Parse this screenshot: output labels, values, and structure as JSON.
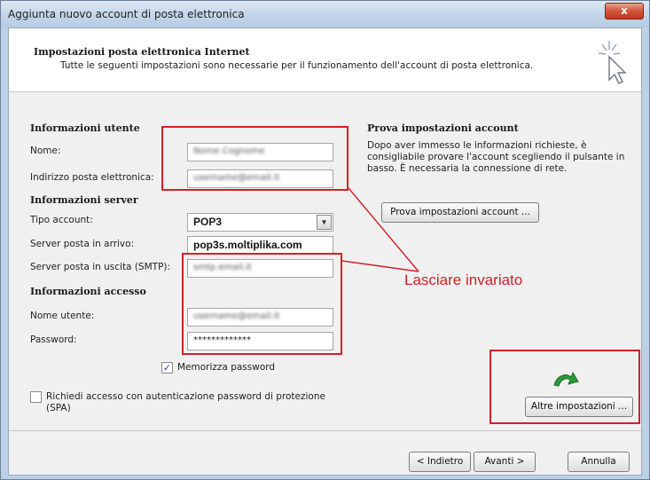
{
  "window": {
    "title": "Aggiunta nuovo account di posta elettronica",
    "close_label": "x"
  },
  "header": {
    "title": "Impostazioni posta elettronica Internet",
    "subtitle": "Tutte le seguenti impostazioni sono necessarie per il funzionamento dell'account di posta elettronica."
  },
  "user_info": {
    "section": "Informazioni utente",
    "name_label": "Nome:",
    "name_value": "Nome Cognome",
    "email_label": "Indirizzo posta elettronica:",
    "email_value": "username@email.it"
  },
  "server_info": {
    "section": "Informazioni server",
    "account_type_label": "Tipo account:",
    "account_type_value": "POP3",
    "incoming_label": "Server posta in arrivo:",
    "incoming_value": "pop3s.moltiplika.com",
    "outgoing_label": "Server posta in uscita (SMTP):",
    "outgoing_value": "smtp.email.it"
  },
  "logon_info": {
    "section": "Informazioni accesso",
    "username_label": "Nome utente:",
    "username_value": "username@email.it",
    "password_label": "Password:",
    "password_value": "*************",
    "remember_label": "Memorizza password",
    "spa_label": "Richiedi accesso con autenticazione password di protezione (SPA)"
  },
  "test": {
    "section": "Prova impostazioni account",
    "description": "Dopo aver immesso le informazioni richieste, è consigliabile provare l'account scegliendo il pulsante in basso. È necessaria la connessione di rete.",
    "button": "Prova impostazioni account ..."
  },
  "annotation": {
    "text": "Lasciare invariato"
  },
  "more_settings": {
    "button": "Altre impostazioni ..."
  },
  "footer": {
    "back": "< Indietro",
    "next": "Avanti >",
    "cancel": "Annulla"
  },
  "colors": {
    "annotation": "#d42029",
    "arrow": "#2a9a3a"
  }
}
